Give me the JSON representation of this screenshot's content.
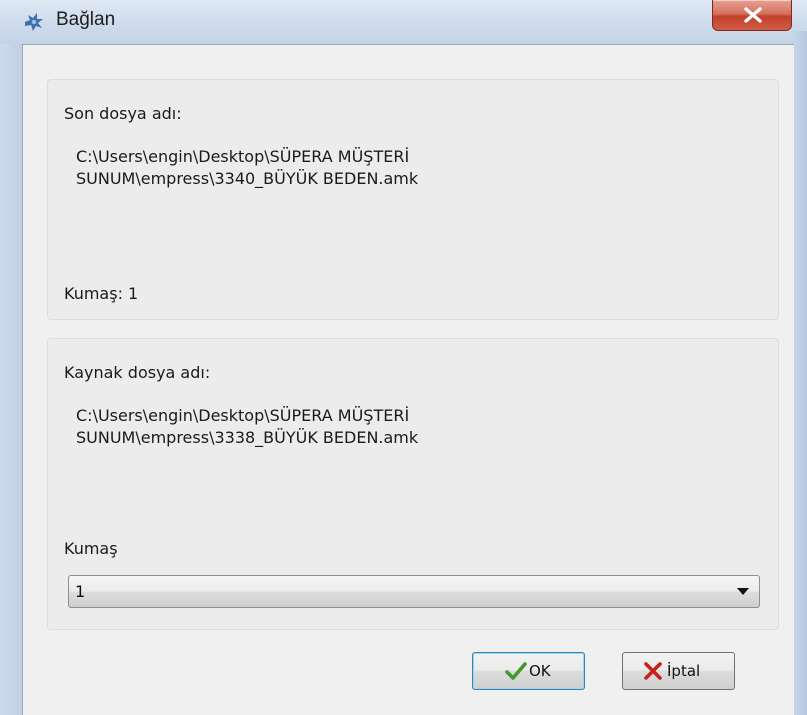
{
  "window": {
    "title": "Bağlan",
    "title_icon": "app-star-icon",
    "close_icon": "close-x-icon"
  },
  "last_file": {
    "label": "Son dosya adı:",
    "path_line1": "C:\\Users\\engin\\Desktop\\SÜPERA MÜŞTERİ",
    "path_line2": "SUNUM\\empress\\3340_BÜYÜK BEDEN.amk",
    "fabric_text": "Kumaş: 1"
  },
  "source_file": {
    "label": "Kaynak dosya adı:",
    "path_line1": "C:\\Users\\engin\\Desktop\\SÜPERA MÜŞTERİ",
    "path_line2": "SUNUM\\empress\\3338_BÜYÜK BEDEN.amk",
    "fabric_label": "Kumaş",
    "fabric_selected": "1"
  },
  "buttons": {
    "ok_label": "OK",
    "ok_icon": "checkmark-icon",
    "cancel_label": "İptal",
    "cancel_icon": "red-x-icon"
  },
  "colors": {
    "close_red": "#c2402a",
    "ok_check_green": "#3f9a2a",
    "cancel_x_red": "#c8201a"
  }
}
